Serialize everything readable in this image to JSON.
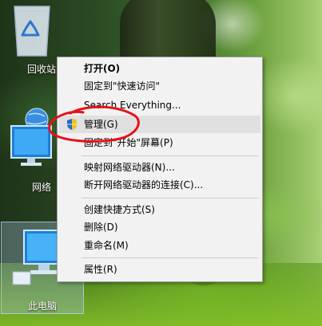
{
  "desktop": {
    "icons": [
      {
        "label": "回收站"
      },
      {
        "label": "网络"
      },
      {
        "label": "此电脑"
      }
    ]
  },
  "context_menu": {
    "items": [
      {
        "label": "打开(O)"
      },
      {
        "label": "固定到\"快速访问\""
      },
      {
        "label": "Search Everything..."
      },
      {
        "label": "管理(G)"
      },
      {
        "label": "固定到\"开始\"屏幕(P)"
      },
      {
        "label": "映射网络驱动器(N)..."
      },
      {
        "label": "断开网络驱动器的连接(C)..."
      },
      {
        "label": "创建快捷方式(S)"
      },
      {
        "label": "删除(D)"
      },
      {
        "label": "重命名(M)"
      },
      {
        "label": "属性(R)"
      }
    ]
  },
  "colors": {
    "annotation_red": "#e8101a",
    "menu_background": "#f2f2f2",
    "hover_background": "#e0e0e0",
    "shield_blue": "#2a66c8",
    "shield_yellow": "#f2c20f"
  }
}
